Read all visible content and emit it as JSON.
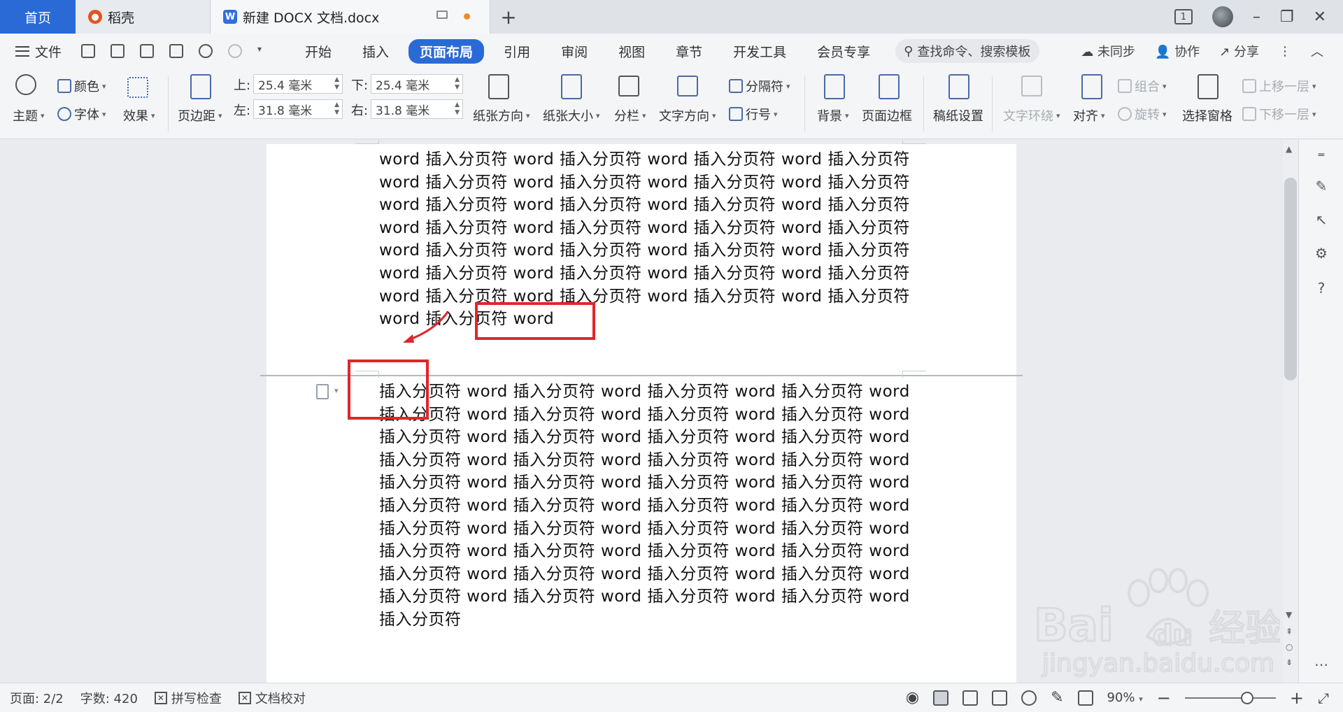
{
  "tabs": {
    "home": "首页",
    "daoke": "稻壳",
    "doc": "新建 DOCX 文档.docx",
    "add": "+"
  },
  "window": {
    "page_count_badge": "1"
  },
  "menu": {
    "file": "文件",
    "items": [
      "开始",
      "插入",
      "页面布局",
      "引用",
      "审阅",
      "视图",
      "章节",
      "开发工具",
      "会员专享"
    ],
    "search_placeholder": "查找命令、搜索模板",
    "sync": "未同步",
    "collab": "协作",
    "share": "分享"
  },
  "ribbon": {
    "theme": "主题",
    "color": "颜色",
    "font": "字体",
    "effect": "效果",
    "margin": "页边距",
    "top_label": "上:",
    "top_value": "25.4 毫米",
    "bottom_label": "下:",
    "bottom_value": "25.4 毫米",
    "left_label": "左:",
    "left_value": "31.8 毫米",
    "right_label": "右:",
    "right_value": "31.8 毫米",
    "orientation": "纸张方向",
    "size": "纸张大小",
    "columns": "分栏",
    "text_direction": "文字方向",
    "separator": "分隔符",
    "line_number": "行号",
    "background": "背景",
    "page_border": "页面边框",
    "paper_setup": "稿纸设置",
    "text_wrap": "文字环绕",
    "align": "对齐",
    "group": "组合",
    "rotate": "旋转",
    "selection_pane": "选择窗格",
    "bring_forward": "上移一层",
    "send_backward": "下移一层"
  },
  "document": {
    "page1_lines": [
      "word 插入分页符 word 插入分页符 word 插入分页符 word 插入分页符",
      "word 插入分页符 word 插入分页符 word 插入分页符 word 插入分页符",
      "word 插入分页符 word 插入分页符 word 插入分页符 word 插入分页符",
      "word 插入分页符 word 插入分页符 word 插入分页符 word 插入分页符",
      "word 插入分页符 word 插入分页符 word 插入分页符 word 插入分页符",
      "word 插入分页符 word 插入分页符 word 插入分页符 word 插入分页符",
      "word 插入分页符 word 插入分页符 word 插入分页符 word 插入分页符",
      "word 插入分页符 word"
    ],
    "page2_lines": [
      "插入分页符 word 插入分页符 word 插入分页符 word 插入分页符 word",
      "插入分页符 word 插入分页符 word 插入分页符 word 插入分页符 word",
      "插入分页符 word 插入分页符 word 插入分页符 word 插入分页符 word",
      "插入分页符 word 插入分页符 word 插入分页符 word 插入分页符 word",
      "插入分页符 word 插入分页符 word 插入分页符 word 插入分页符 word",
      "插入分页符 word 插入分页符 word 插入分页符 word 插入分页符 word",
      "插入分页符 word 插入分页符 word 插入分页符 word 插入分页符 word",
      "插入分页符 word 插入分页符 word 插入分页符 word 插入分页符 word",
      "插入分页符 word 插入分页符 word 插入分页符 word 插入分页符 word",
      "插入分页符 word 插入分页符 word 插入分页符 word 插入分页符 word",
      "插入分页符"
    ]
  },
  "status": {
    "page": "页面: 2/2",
    "words": "字数: 420",
    "spell": "拼写检查",
    "proof": "文档校对",
    "zoom": "90%"
  },
  "watermark": {
    "brand": "Bai",
    "brand2": "du",
    "cn": "经验",
    "url": "jingyan.baidu.com"
  },
  "colors": {
    "accent": "#2a6ad6",
    "highlight": "#e0262b",
    "doc_icon": "#2f6fde",
    "daoke_icon": "#e6531d"
  }
}
